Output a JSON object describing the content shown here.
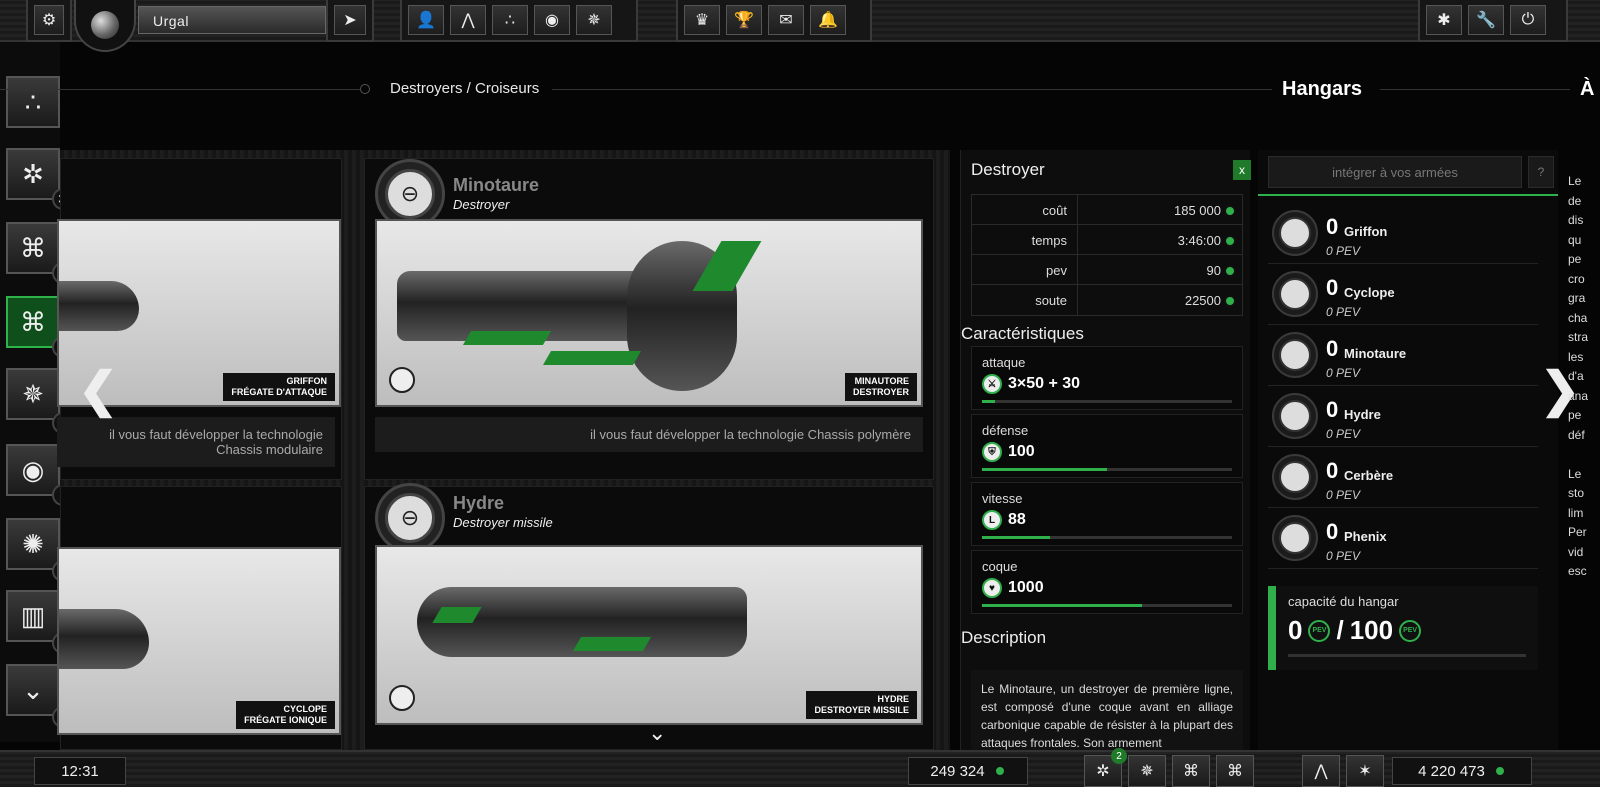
{
  "topbar": {
    "planet_name": "Urgal",
    "icons_left": [
      "gear-icon"
    ],
    "icons_group2": [
      "user-icon",
      "tower-icon",
      "dots-icon",
      "clock-icon",
      "compass-icon"
    ],
    "icons_group3": [
      "trophy-cup-icon",
      "trophy-icon",
      "mail-icon",
      "bell-icon"
    ],
    "icons_right": [
      "bug-icon",
      "wrench-icon",
      "power-icon"
    ]
  },
  "left_nav": {
    "items": [
      {
        "icon": "dots-icon",
        "count": ""
      },
      {
        "icon": "gear-wheel-icon",
        "count": "33"
      },
      {
        "icon": "frigate-icon",
        "count": "22"
      },
      {
        "icon": "destroyer-icon",
        "count": "1"
      },
      {
        "icon": "star-icon",
        "count": "22"
      },
      {
        "icon": "target-icon",
        "count": "1"
      },
      {
        "icon": "burst-icon",
        "count": "1"
      },
      {
        "icon": "city-icon",
        "count": "32"
      },
      {
        "icon": "chevron-down-icon",
        "count": "32"
      }
    ]
  },
  "breadcrumb": "Destroyers / Croiseurs",
  "page_title": "Hangars",
  "page_title_next": "À",
  "cards": [
    {
      "name": "",
      "type": "",
      "tag1": "GRIFFON",
      "tag2": "FRÉGATE D'ATTAQUE",
      "requirement": "il vous faut développer la technologie Chassis modulaire"
    },
    {
      "name": "Minotaure",
      "type": "Destroyer",
      "tag1": "MINAUTORE",
      "tag2": "DESTROYER",
      "requirement": "il vous faut développer la technologie Chassis polymère"
    },
    {
      "name": "",
      "type": "",
      "tag1": "CYCLOPE",
      "tag2": "FRÉGATE IONIQUE",
      "requirement": ""
    },
    {
      "name": "Hydre",
      "type": "Destroyer missile",
      "tag1": "HYDRE",
      "tag2": "DESTROYER MISSILE",
      "requirement": ""
    }
  ],
  "details": {
    "title": "Destroyer",
    "close": "x",
    "rows": [
      {
        "key": "coût",
        "value": "185 000"
      },
      {
        "key": "temps",
        "value": "3:46:00"
      },
      {
        "key": "pev",
        "value": "90"
      },
      {
        "key": "soute",
        "value": "22500"
      }
    ],
    "caract_title": "Caractéristiques",
    "caract": [
      {
        "label": "attaque",
        "value": "3×50 + 30",
        "level": 0.05
      },
      {
        "label": "défense",
        "value": "100",
        "level": 0.5
      },
      {
        "label": "vitesse",
        "value": "88",
        "level": 0.27
      },
      {
        "label": "coque",
        "value": "1000",
        "level": 0.64
      }
    ],
    "desc_title": "Description",
    "description": "Le Minotaure, un destroyer de première ligne, est composé d'une coque avant en alliage carbonique capable de résister à la plupart des attaques frontales. Son armement"
  },
  "hangar": {
    "integrate_placeholder": "intégrer à vos armées",
    "help": "?",
    "ships": [
      {
        "count": "0",
        "name": "Griffon",
        "pev": "0 PEV"
      },
      {
        "count": "0",
        "name": "Cyclope",
        "pev": "0 PEV"
      },
      {
        "count": "0",
        "name": "Minotaure",
        "pev": "0 PEV"
      },
      {
        "count": "0",
        "name": "Hydre",
        "pev": "0 PEV"
      },
      {
        "count": "0",
        "name": "Cerbère",
        "pev": "0 PEV"
      },
      {
        "count": "0",
        "name": "Phenix",
        "pev": "0 PEV"
      }
    ],
    "capacity_label": "capacité du hangar",
    "capacity_used": "0",
    "capacity_sep": "/",
    "capacity_max": "100"
  },
  "side_text": [
    "Le",
    "de",
    "dis",
    "qu",
    "pe",
    "cro",
    "gra",
    "cha",
    "stra",
    "les",
    "d'a",
    "ana",
    "pe",
    "déf",
    "",
    "Le",
    "sto",
    "lim",
    "Per",
    "vid",
    "esc"
  ],
  "bottombar": {
    "time": "12:31",
    "resource1": "249 324",
    "badge": "2",
    "resource2": "4 220 473"
  }
}
